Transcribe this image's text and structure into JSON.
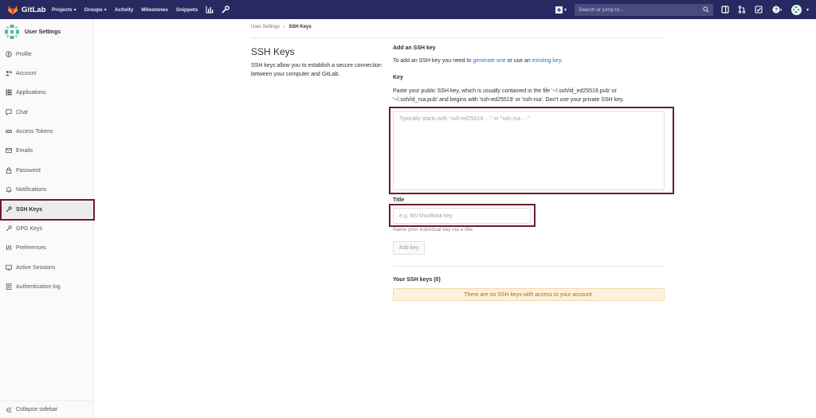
{
  "navbar": {
    "brand": "GitLab",
    "items": [
      {
        "label": "Projects",
        "has_caret": true
      },
      {
        "label": "Groups",
        "has_caret": true
      },
      {
        "label": "Activity",
        "has_caret": false
      },
      {
        "label": "Milestones",
        "has_caret": false
      },
      {
        "label": "Snippets",
        "has_caret": false
      }
    ],
    "search_placeholder": "Search or jump to...",
    "icons": [
      "chart-icon",
      "wrench-icon",
      "plus-icon",
      "search-icon",
      "sidebar-toggle-icon",
      "merge-request-icon",
      "todo-check-icon",
      "help-icon",
      "avatar"
    ]
  },
  "sidebar": {
    "title": "User Settings",
    "items": [
      {
        "label": "Profile",
        "icon": "profile-icon"
      },
      {
        "label": "Account",
        "icon": "account-icon"
      },
      {
        "label": "Applications",
        "icon": "applications-icon"
      },
      {
        "label": "Chat",
        "icon": "chat-icon"
      },
      {
        "label": "Access Tokens",
        "icon": "token-icon"
      },
      {
        "label": "Emails",
        "icon": "mail-icon"
      },
      {
        "label": "Password",
        "icon": "lock-icon"
      },
      {
        "label": "Notifications",
        "icon": "bell-icon"
      },
      {
        "label": "SSH Keys",
        "icon": "key-icon",
        "active": true
      },
      {
        "label": "GPG Keys",
        "icon": "key-icon"
      },
      {
        "label": "Preferences",
        "icon": "preferences-icon"
      },
      {
        "label": "Active Sessions",
        "icon": "sessions-icon"
      },
      {
        "label": "Authentication log",
        "icon": "log-icon"
      }
    ],
    "collapse_label": "Collapse sidebar"
  },
  "breadcrumb": {
    "parent": "User Settings",
    "separator": "›",
    "current": "SSH Keys"
  },
  "page": {
    "title": "SSH Keys",
    "description": "SSH keys allow you to establish a secure connection between your computer and GitLab."
  },
  "form": {
    "heading": "Add an SSH key",
    "intro_prefix": "To add an SSH key you need to ",
    "intro_link1": "generate one",
    "intro_mid": " or use an ",
    "intro_link2": "existing key",
    "intro_suffix": ".",
    "key_label": "Key",
    "key_help": "Paste your public SSH key, which is usually contained in the file '~/.ssh/id_ed25519.pub' or '~/.ssh/id_rsa.pub' and begins with 'ssh-ed25519' or 'ssh-rsa'. Don't use your private SSH key.",
    "key_value": "",
    "key_placeholder": "Typically starts with \"ssh-ed25519 …\" or \"ssh-rsa …\"",
    "title_label": "Title",
    "title_value": "",
    "title_placeholder": "e.g. My MacBook key",
    "title_help": "Name your individual key via a title",
    "submit_label": "Add key"
  },
  "your_keys": {
    "heading": "Your SSH keys (0)",
    "empty_message": "There are no SSH keys with access to your account."
  },
  "colors": {
    "navbar": "#292961",
    "highlight": "#6f1b2b",
    "link": "#1f78d1",
    "alert_bg": "#fdf1dd"
  }
}
